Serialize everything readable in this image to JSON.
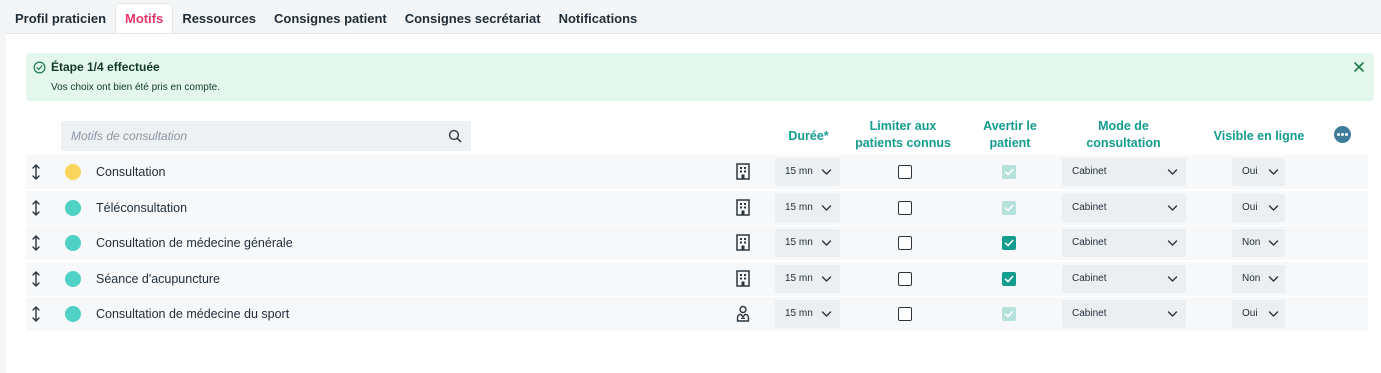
{
  "tabs": [
    {
      "label": "Profil praticien"
    },
    {
      "label": "Motifs"
    },
    {
      "label": "Ressources"
    },
    {
      "label": "Consignes patient"
    },
    {
      "label": "Consignes secrétariat"
    },
    {
      "label": "Notifications"
    }
  ],
  "active_tab": "Motifs",
  "alert": {
    "title": "Étape 1/4 effectuée",
    "message": "Vos choix ont bien été pris en compte."
  },
  "search": {
    "placeholder": "Motifs de consultation"
  },
  "columns": {
    "duree": "Durée*",
    "limit_line1": "Limiter aux",
    "limit_line2": "patients connus",
    "warn_line1": "Avertir le",
    "warn_line2": "patient",
    "mode_line1": "Mode de",
    "mode_line2": "consultation",
    "visible": "Visible en ligne"
  },
  "colors": {
    "accent": "#139d8f",
    "tab_active": "#e5386d",
    "alert_bg": "#e4f7ec"
  },
  "rows": [
    {
      "name": "Consultation",
      "dot_color": "#f9d65b",
      "place_icon": "building-icon",
      "duration": "15 mn",
      "limit_known": false,
      "warn_patient": "checked-disabled",
      "mode": "Cabinet",
      "visible": "Oui"
    },
    {
      "name": "Téléconsultation",
      "dot_color": "#4fd1c5",
      "place_icon": "building-icon",
      "duration": "15 mn",
      "limit_known": false,
      "warn_patient": "checked-disabled",
      "mode": "Cabinet",
      "visible": "Oui"
    },
    {
      "name": "Consultation de médecine générale",
      "dot_color": "#4fd1c5",
      "place_icon": "building-icon",
      "duration": "15 mn",
      "limit_known": false,
      "warn_patient": "checked",
      "mode": "Cabinet",
      "visible": "Non"
    },
    {
      "name": "Séance d'acupuncture",
      "dot_color": "#4fd1c5",
      "place_icon": "building-icon",
      "duration": "15 mn",
      "limit_known": false,
      "warn_patient": "checked",
      "mode": "Cabinet",
      "visible": "Non"
    },
    {
      "name": "Consultation de médecine du sport",
      "dot_color": "#4fd1c5",
      "place_icon": "doctor-icon",
      "duration": "15 mn",
      "limit_known": false,
      "warn_patient": "checked-disabled",
      "mode": "Cabinet",
      "visible": "Oui"
    }
  ]
}
